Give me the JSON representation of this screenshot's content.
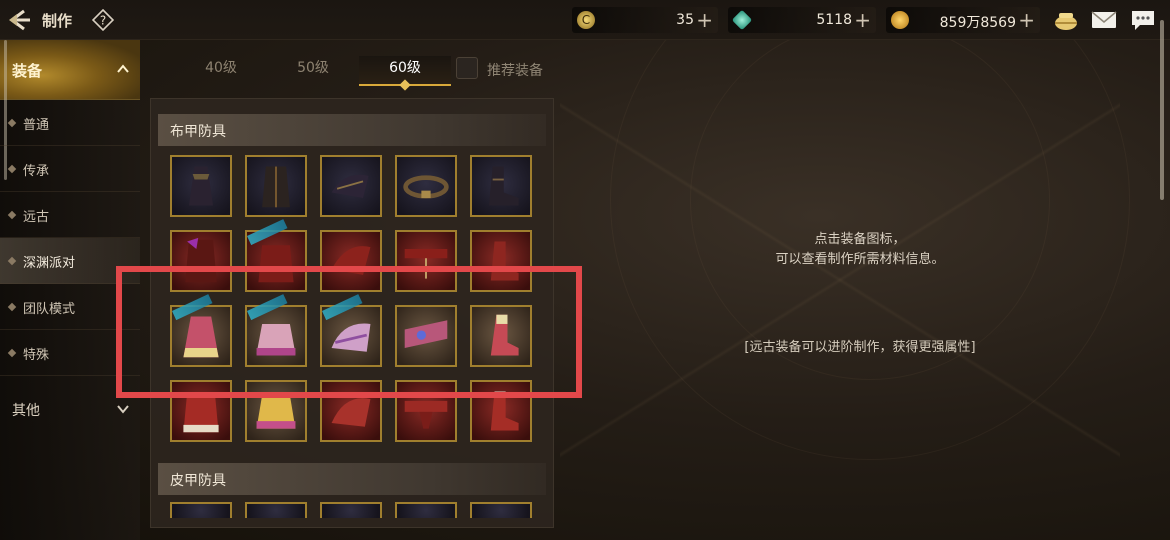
{
  "header": {
    "title": "制作",
    "resources": [
      {
        "name": "crystal-coin",
        "value": "35",
        "color": "#d8b64a"
      },
      {
        "name": "gem",
        "value": "5118",
        "color": "#3fc4a5"
      },
      {
        "name": "gold",
        "value": "859万8569",
        "color": "#e0a52a"
      }
    ]
  },
  "sidebar": {
    "header_label": "装备",
    "items": [
      {
        "label": "普通"
      },
      {
        "label": "传承"
      },
      {
        "label": "远古"
      },
      {
        "label": "深渊派对",
        "active": true
      },
      {
        "label": "团队模式"
      },
      {
        "label": "特殊"
      }
    ],
    "other_label": "其他"
  },
  "tabs": [
    {
      "label": "40级"
    },
    {
      "label": "50级"
    },
    {
      "label": "60级",
      "active": true
    }
  ],
  "recommend_label": "推荐装备",
  "sections": [
    {
      "label": "布甲防具"
    },
    {
      "label": "皮甲防具"
    }
  ],
  "info": {
    "line1": "点击装备图标，",
    "line2": "可以查看制作所需材料信息。",
    "note": "[远古装备可以进阶制作，获得更强属性]"
  },
  "colors": {
    "accent_gold": "#d9a93a",
    "highlight_red": "#e2484a"
  }
}
